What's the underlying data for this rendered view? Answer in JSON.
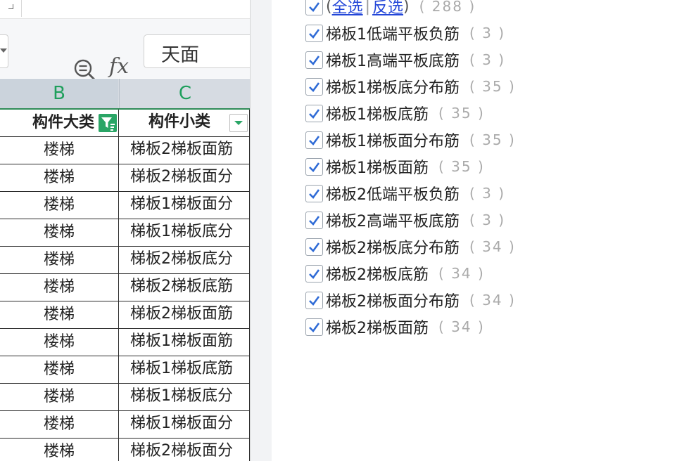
{
  "formula_bar": {
    "fx_label": "fx",
    "value": "天面"
  },
  "columns": [
    {
      "letter": "B"
    },
    {
      "letter": "C"
    }
  ],
  "table": {
    "headers": [
      "构件大类",
      "构件小类"
    ],
    "rows": [
      [
        "楼梯",
        "梯板2梯板面筋"
      ],
      [
        "楼梯",
        "梯板2梯板面分"
      ],
      [
        "楼梯",
        "梯板1梯板面分"
      ],
      [
        "楼梯",
        "梯板1梯板底分"
      ],
      [
        "楼梯",
        "梯板2梯板底分"
      ],
      [
        "楼梯",
        "梯板2梯板底筋"
      ],
      [
        "楼梯",
        "梯板2梯板面筋"
      ],
      [
        "楼梯",
        "梯板1梯板面筋"
      ],
      [
        "楼梯",
        "梯板1梯板底筋"
      ],
      [
        "楼梯",
        "梯板1梯板底分"
      ],
      [
        "楼梯",
        "梯板1梯板面分"
      ],
      [
        "楼梯",
        "梯板2梯板面分"
      ]
    ]
  },
  "filter_list": {
    "select_all": {
      "open_paren": "(",
      "select_all_label": "全选",
      "separator": "|",
      "invert_label": "反选",
      "close_paren": ")",
      "count": "( 288 )"
    },
    "items": [
      {
        "label": "梯板1低端平板负筋",
        "count": "( 3 )"
      },
      {
        "label": "梯板1高端平板底筋",
        "count": "( 3 )"
      },
      {
        "label": "梯板1梯板底分布筋",
        "count": "( 35 )"
      },
      {
        "label": "梯板1梯板底筋",
        "count": "( 35 )"
      },
      {
        "label": "梯板1梯板面分布筋",
        "count": "( 35 )"
      },
      {
        "label": "梯板1梯板面筋",
        "count": "( 35 )"
      },
      {
        "label": "梯板2低端平板负筋",
        "count": "( 3 )"
      },
      {
        "label": "梯板2高端平板底筋",
        "count": "( 3 )"
      },
      {
        "label": "梯板2梯板底分布筋",
        "count": "( 34 )"
      },
      {
        "label": "梯板2梯板底筋",
        "count": "( 34 )"
      },
      {
        "label": "梯板2梯板面分布筋",
        "count": "( 34 )"
      },
      {
        "label": "梯板2梯板面筋",
        "count": "( 34 )"
      }
    ]
  },
  "colors": {
    "checkbox_tick": "#2f6bd6",
    "filter_active": "#2aa566",
    "column_letter": "#1f9f5c",
    "link": "#2346d8"
  }
}
